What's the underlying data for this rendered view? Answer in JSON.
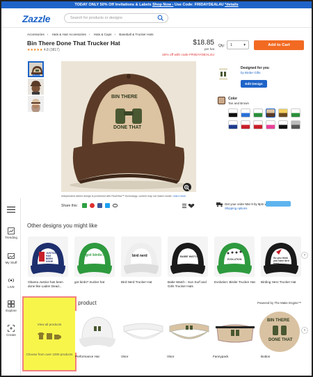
{
  "promo": {
    "text1": "TODAY ONLY ",
    "text2": "50% Off Invitations & Labels",
    "shop": "Shop Now ›",
    "code": " Use Code: FRIDAYDEAL4U ",
    "details": "*details"
  },
  "header": {
    "logo": "Zazzle",
    "search_placeholder": "Search for products or designs"
  },
  "breadcrumb": [
    "Accessories",
    "Hats & Hair Accessories",
    "Hats & Caps",
    "Baseball & Trucker Hats"
  ],
  "product": {
    "title": "Bin There Done That Trucker Hat",
    "stars": "★★★★★",
    "rating": "4.8 (3817)",
    "price": "$18.85",
    "per": "per hat",
    "discount": "15% off with code FRIDAYDEAL4U",
    "qty_label": "Qty:",
    "qty_value": "1",
    "add_to_cart": "Add to Cart",
    "disclaimer": "Independent artist's design is previewed with RealView™ technology; content may not match model. ",
    "learn_more": "Learn more",
    "share_label": "Share this:",
    "designed_for": "Designed for you",
    "by": "by Birder Gifts",
    "edit_design": "Edit Design",
    "color_label": "Color",
    "color_value": "Tan and Brown",
    "deliver": "Get your order Mar 9 by 9pm with",
    "shipping": "Shipping options",
    "accent": "#1e64c8",
    "cart_color": "#f26a22"
  },
  "thumb_labels": {
    "front": "Front"
  },
  "sidebar": [
    "Trending",
    "My Stuff",
    "LIVE",
    "Explore",
    "Create"
  ],
  "other_designs": {
    "title": "Other designs you might like",
    "cards": [
      {
        "label": "Obama Justice has been done like Laden Dead..."
      },
      {
        "label": "got birds? trucker hat"
      },
      {
        "label": "Bird Nerd Trucker Hat"
      },
      {
        "label": "Babe Watch - Sun Surf and Girls Trucker Hats"
      },
      {
        "label": "Evolution: Birder Trucker Hat"
      },
      {
        "label": "Birding Hero Trucker Hat"
      }
    ],
    "card_texts": [
      "JUSTICE HAS BEEN DONE",
      "got birds?",
      "bird nerd",
      "BABE WATCH",
      "EVOLUTION",
      "So you think you have bird nerd"
    ]
  },
  "transfer": {
    "title": "Transfer design to a product",
    "powered": "Powered by The Make Engine™",
    "view_all": "View all products",
    "choose": "Choose from over 1000 products",
    "products": [
      "Performance Hat",
      "Visor",
      "Visor",
      "Fannypack",
      "Button"
    ]
  },
  "hat_text": {
    "line1": "BIN THERE",
    "line2": "DONE THAT"
  }
}
